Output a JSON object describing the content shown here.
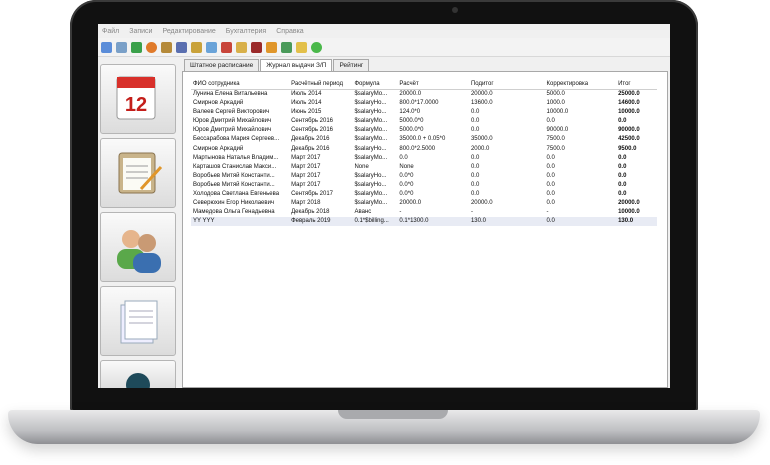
{
  "menu": [
    "Файл",
    "Записи",
    "Редактирование",
    "Бухгалтерия",
    "Справка"
  ],
  "toolbar_icons": [
    "refresh-icon",
    "copy-icon",
    "add-user-icon",
    "delete-icon",
    "home-icon",
    "book-icon",
    "key-icon",
    "image-icon",
    "cut-icon",
    "print-icon",
    "filter-icon",
    "export-icon",
    "users-icon",
    "folder-icon",
    "chat-icon"
  ],
  "sidebar": {
    "calendar_day": "12",
    "items": [
      "calendar",
      "clipboard",
      "users",
      "documents",
      "more"
    ]
  },
  "tabs": [
    {
      "label": "Штатное расписание",
      "active": false
    },
    {
      "label": "Журнал выдачи З/П",
      "active": true
    },
    {
      "label": "Рейтинг",
      "active": false
    }
  ],
  "table": {
    "headers": [
      "ФИО сотрудника",
      "Расчётный период",
      "Формула",
      "Расчёт",
      "Подитог",
      "Корректировка",
      "Итог"
    ],
    "rows": [
      [
        "Лунина Елена Витальевна",
        "Июль 2014",
        "$salaryMo...",
        "20000.0",
        "20000.0",
        "5000.0",
        "25000.0"
      ],
      [
        "Смирнов Аркадий",
        "Июль 2014",
        "$salaryHo...",
        "800.0*17.0000",
        "13600.0",
        "1000.0",
        "14600.0"
      ],
      [
        "Валеев Сергей Викторович",
        "Июнь 2015",
        "$salaryHo...",
        "124.0*0",
        "0.0",
        "10000.0",
        "10000.0"
      ],
      [
        "Юров Дмитрий Михайлович",
        "Сентябрь 2016",
        "$salaryMo...",
        "5000.0*0",
        "0.0",
        "0.0",
        "0.0"
      ],
      [
        "Юров Дмитрий Михайлович",
        "Сентябрь 2016",
        "$salaryMo...",
        "5000.0*0",
        "0.0",
        "90000.0",
        "90000.0"
      ],
      [
        "Бессарабова Мария Сергеев...",
        "Декабрь 2016",
        "$salaryMo...",
        "35000.0 + 0.05*0",
        "35000.0",
        "7500.0",
        "42500.0"
      ],
      [
        "Смирнов Аркадий",
        "Декабрь 2016",
        "$salaryHo...",
        "800.0*2.5000",
        "2000.0",
        "7500.0",
        "9500.0"
      ],
      [
        "Мартынова Наталья Владим...",
        "Март 2017",
        "$salaryMo...",
        "0.0",
        "0.0",
        "0.0",
        "0.0"
      ],
      [
        "Карташов Станислав Макси...",
        "Март 2017",
        "None",
        "None",
        "0.0",
        "0.0",
        "0.0"
      ],
      [
        "Воробьев Митяй Константи...",
        "Март 2017",
        "$salaryHo...",
        "0.0*0",
        "0.0",
        "0.0",
        "0.0"
      ],
      [
        "Воробьев Митяй Константи...",
        "Март 2017",
        "$salaryHo...",
        "0.0*0",
        "0.0",
        "0.0",
        "0.0"
      ],
      [
        "Холодова Светлана Евгеньева",
        "Сентябрь 2017",
        "$salaryMo...",
        "0.0*0",
        "0.0",
        "0.0",
        "0.0"
      ],
      [
        "Северюхин Егор Николаевич",
        "Март 2018",
        "$salaryMo...",
        "20000.0",
        "20000.0",
        "0.0",
        "20000.0"
      ],
      [
        "Мамедова Ольга Генадьевна",
        "Декабрь 2018",
        "Аванс",
        "-",
        "-",
        "-",
        "10000.0"
      ],
      [
        "YY YYY",
        "Февраль 2019",
        "0.1*$billing...",
        "0.1*1300.0",
        "130.0",
        "0.0",
        "130.0"
      ]
    ]
  },
  "colors": {
    "selected_row": "#e8ebf4",
    "flag": "#3b6fd0"
  }
}
